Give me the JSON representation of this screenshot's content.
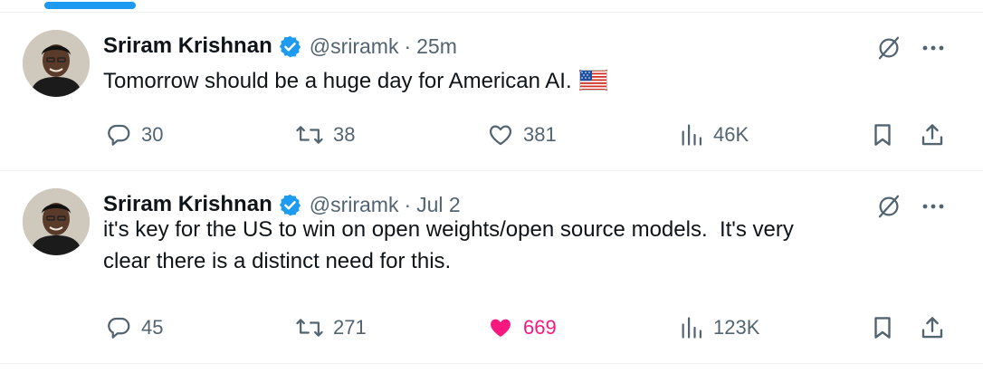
{
  "tweets": [
    {
      "author": {
        "name": "Sriram Krishnan",
        "handle": "@sriramk"
      },
      "separator": "·",
      "time": "25m",
      "text": "Tomorrow should be a huge day for American AI.",
      "emoji": "us-flag",
      "stats": {
        "replies": "30",
        "reposts": "38",
        "likes": "381",
        "views": "46K"
      },
      "liked": false
    },
    {
      "author": {
        "name": "Sriram Krishnan",
        "handle": "@sriramk"
      },
      "separator": "·",
      "time": "Jul 2",
      "text_lines": [
        "it's key for the US to win on open weights/open source models.  It's very",
        "clear there is a distinct need for this."
      ],
      "stats": {
        "replies": "45",
        "reposts": "271",
        "likes": "669",
        "views": "123K"
      },
      "liked": true
    }
  ],
  "colors": {
    "accent": "#1d9bf0",
    "like": "#f91880",
    "muted": "#536471",
    "text": "#0f1419"
  },
  "icons": [
    "verified-badge-icon",
    "grok-icon",
    "more-icon",
    "reply-icon",
    "repost-icon",
    "like-icon",
    "views-icon",
    "bookmark-icon",
    "share-icon"
  ]
}
